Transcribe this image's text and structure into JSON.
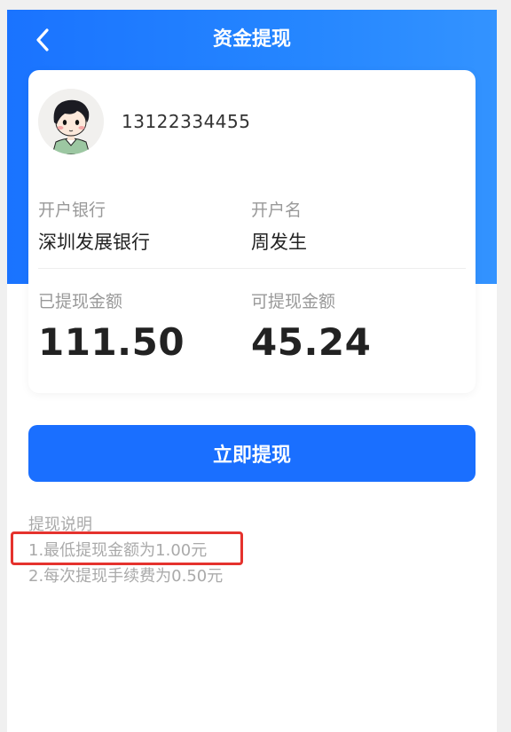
{
  "header": {
    "title": "资金提现",
    "back_icon": "chevron-left-icon"
  },
  "account": {
    "avatar_icon": "cartoon-boy-avatar",
    "phone": "13122334455",
    "bank_label": "开户银行",
    "bank_value": "深圳发展银行",
    "holder_label": "开户名",
    "holder_value": "周发生",
    "withdrawn_label": "已提现金额",
    "withdrawn_value": "111.50",
    "available_label": "可提现金额",
    "available_value": "45.24"
  },
  "actions": {
    "withdraw_label": "立即提现"
  },
  "notes": {
    "title": "提现说明",
    "items": [
      "1.最低提现金额为1.00元",
      "2.每次提现手续费为0.50元"
    ]
  },
  "colors": {
    "primary": "#1a6fff",
    "header_gradient_start": "#1a73ff",
    "header_gradient_end": "#3393ff",
    "annotation_red": "#e5322d"
  }
}
